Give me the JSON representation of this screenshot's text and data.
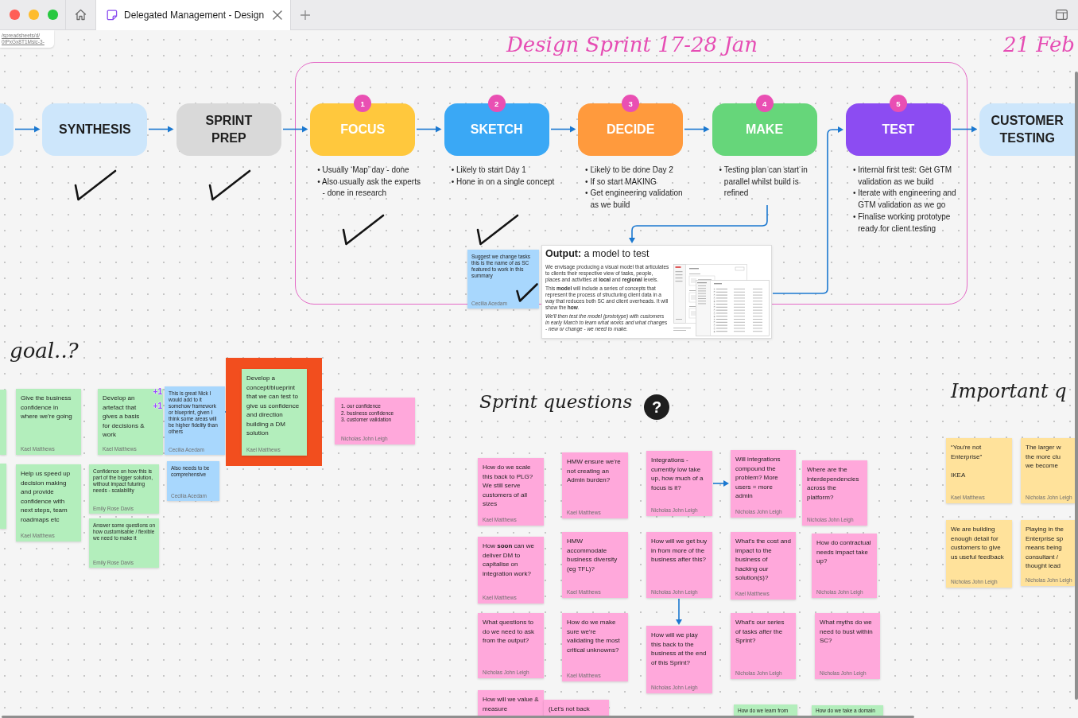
{
  "tab_bar": {
    "tabs": [
      {
        "title": "Delegated Management - Design",
        "selected": true
      }
    ]
  },
  "link_card": {
    "lines": [
      "/spreadsheets/d/",
      "0tPxGx8T1Msic-3-"
    ]
  },
  "sprint_frame": {
    "title": "Design Sprint 17-28 Jan"
  },
  "next_frame": {
    "title": "21 Feb"
  },
  "process": {
    "stages": [
      {
        "color": "#cde6fb",
        "done": false
      },
      {
        "label": "SYNTHESIS",
        "color": "#cde6fb",
        "done": true
      },
      {
        "label": "SPRINT PREP",
        "color": "#d9d9d9",
        "done": true
      },
      {
        "number": "1",
        "label": "FOCUS",
        "color": "#ffc83d",
        "done": true,
        "notes": [
          "• Usually ‘Map’ day - done",
          "• Also usually ask the experts - done in research"
        ]
      },
      {
        "number": "2",
        "label": "SKETCH",
        "color": "#3aa8f5",
        "done": true,
        "notes": [
          "• Likely to start Day 1",
          "• Hone in on a single concept"
        ]
      },
      {
        "number": "3",
        "label": "DECIDE",
        "color": "#ff9a3d",
        "done": false,
        "notes": [
          "• Likely to be done Day 2",
          "• If so start MAKING",
          "• Get engineering validation as we build"
        ]
      },
      {
        "number": "4",
        "label": "MAKE",
        "color": "#66d67a",
        "done": false,
        "notes": [
          "• Testing plan can start in parallel whilst build is refined"
        ]
      },
      {
        "number": "5",
        "label": "TEST",
        "color": "#8c4cf2",
        "done": false,
        "notes": [
          "• Internal first test: Get GTM validation as we build",
          "• Iterate with engineering and GTM validation as we go",
          "• Finalise working prototype ready for client testing"
        ]
      },
      {
        "label": "CUSTOMER TESTING",
        "color": "#cde6fb",
        "done": false
      }
    ]
  },
  "output": {
    "title": "**Output:** a model to test",
    "paragraphs": [
      {
        "kind": "plain",
        "text": "We envisage producing a visual model that articulates to clients their respective view of tasks, people, places and activities at **local** and **regional** levels."
      },
      {
        "kind": "plain",
        "text": "This **model** will include a series of concepts that represent the process of structuring client data in a way that reduces both SC and client overheads. It will show the **how**."
      },
      {
        "kind": "italic",
        "text": "We'll then test the model (prototype) with customers in early March to learn what works and what changes - new or change - we need to make."
      }
    ],
    "comment": {
      "kind": "comment",
      "text": "Suggest we change tasks this is the name of as SC featured to work in this summary",
      "author": "Cecilia Acedam",
      "color": "#a8d7fd",
      "ticked": true
    }
  },
  "goal": {
    "heading": "goal..?",
    "stickies": [
      {
        "kind": "note",
        "color": "#b3eebc",
        "highlighted": false
      },
      {
        "kind": "note",
        "color": "#b3eebc",
        "highlighted": false
      },
      {
        "kind": "note",
        "text": "Give the business confidence in where we're going",
        "author": "Kael Matthews",
        "color": "#b3eebc",
        "highlighted": false
      },
      {
        "kind": "note",
        "text": "Develop an artefact that gives a basis for decisions & work",
        "author": "Kael Matthews",
        "color": "#b3eebc",
        "reactions": [
          "+1",
          "+1"
        ],
        "highlighted": false
      },
      {
        "kind": "comment",
        "text": "This is great Nick I would add to it somehow framework or blueprint, given I think some areas will be higher fidelity than others",
        "author": "Cecilia Acedam",
        "color": "#a8d7fd",
        "highlighted": false
      },
      {
        "kind": "note",
        "text": "Develop a concept/blueprint that we can test to give us confidence and direction building a DM solution",
        "author": "Kael Matthews",
        "color": "#b3eebc",
        "highlighted": true
      },
      {
        "kind": "list",
        "text": "1. our confidence\n2. business confidence\n3. customer validation",
        "author": "Nicholas John Leigh",
        "color": "#ffa8db",
        "highlighted": false
      },
      {
        "kind": "note",
        "text": "Help us speed up decision making and provide confidence with next steps, team roadmaps etc",
        "author": "Kael Matthews",
        "color": "#b3eebc",
        "highlighted": false
      },
      {
        "kind": "comment",
        "text": "Confidence on how this is part of the bigger solution, without impact futuring needs - scalability",
        "author": "Emily Rose Davis",
        "color": "#b3eebc",
        "highlighted": false
      },
      {
        "kind": "comment",
        "text": "Also needs to be comprehensive",
        "author": "Cecilia Acedam",
        "color": "#a8d7fd",
        "highlighted": false
      },
      {
        "kind": "comment",
        "text": "Answer some questions on how customisable / flexible we need to make it",
        "author": "Emily Rose Davis",
        "color": "#b3eebc",
        "highlighted": false
      }
    ]
  },
  "sprint_questions": {
    "heading": "Sprint questions",
    "icon": "?",
    "stickies": [
      {
        "kind": "note",
        "text": "How do we scale this back to PLG? We still serve customers of all sizes",
        "author": "Kael Matthews",
        "color": "#ffa8db"
      },
      {
        "kind": "note",
        "text": "HMW ensure we're not creating an Admin burden?",
        "author": "Kael Matthews",
        "color": "#ffa8db"
      },
      {
        "kind": "note",
        "text": "Integrations - currently low take up, how much of a focus is it?",
        "author": "Nicholas John Leigh",
        "color": "#ffa8db"
      },
      {
        "kind": "note",
        "text": "Will integrations compound the problem? More users = more admin",
        "author": "Nicholas John Leigh",
        "color": "#ffa8db"
      },
      {
        "kind": "note",
        "text": "Where are the interdependencies across the platform?",
        "author": "Nicholas John Leigh",
        "color": "#ffa8db"
      },
      {
        "kind": "note",
        "text": "How **soon** can we deliver DM to capitalise on integration work?",
        "author": "Kael Matthews",
        "color": "#ffa8db"
      },
      {
        "kind": "note",
        "text": "HMW accommodate business diversity (eg TFL)?",
        "author": "Kael Matthews",
        "color": "#ffa8db"
      },
      {
        "kind": "note",
        "text": "How will we get buy in from more of the business after this?",
        "author": "Nicholas John Leigh",
        "color": "#ffa8db"
      },
      {
        "kind": "note",
        "text": "What's the cost and impact to the business of hacking our solution(s)?",
        "author": "Kael Matthews",
        "color": "#ffa8db"
      },
      {
        "kind": "note",
        "text": "How do contractual needs impact take up?",
        "author": "Nicholas John Leigh",
        "color": "#ffa8db"
      },
      {
        "kind": "note",
        "text": "What questions to do we need to ask from the output?",
        "author": "Nicholas John Leigh",
        "color": "#ffa8db"
      },
      {
        "kind": "note",
        "text": "How do we make sure we're validating the most critical unknowns?",
        "author": "Kael Matthews",
        "color": "#ffa8db"
      },
      {
        "kind": "note",
        "text": "How will we play this back to the business at the end of this Sprint?",
        "author": "Nicholas John Leigh",
        "color": "#ffa8db"
      },
      {
        "kind": "note",
        "text": "What's our series of tasks after the Sprint?",
        "author": "Nicholas John Leigh",
        "color": "#ffa8db"
      },
      {
        "kind": "note",
        "text": "What myths do we need to bust within SC?",
        "author": "Nicholas John Leigh",
        "color": "#ffa8db"
      },
      {
        "kind": "note",
        "text": "How will we value & measure",
        "color": "#ffa8db"
      },
      {
        "kind": "note",
        "text": "(Let's not back",
        "color": "#ffa8db"
      },
      {
        "kind": "comment",
        "text": "How do we learn from",
        "color": "#b3eebc"
      },
      {
        "kind": "comment",
        "text": "How do we take a domain",
        "color": "#b3eebc"
      }
    ]
  },
  "important": {
    "heading": "Important q",
    "stickies": [
      {
        "kind": "note",
        "text": "“You're not Enterprise”\n\nIKEA",
        "author": "Kael Matthews",
        "color": "#ffe29b"
      },
      {
        "kind": "note",
        "text": "The larger w\nthe more clu\nwe become",
        "author": "Nicholas John Leigh",
        "color": "#ffe29b"
      },
      {
        "kind": "note",
        "text": "We are building enough detail for customers to give us useful feedback",
        "author": "Nicholas John Leigh",
        "color": "#ffe29b"
      },
      {
        "kind": "note",
        "text": "Playing in the\nEnterprise sp\nmeans being\nconsultant /\nthought lead",
        "author": "Nicholas John Leigh",
        "color": "#ffe29b"
      }
    ]
  }
}
